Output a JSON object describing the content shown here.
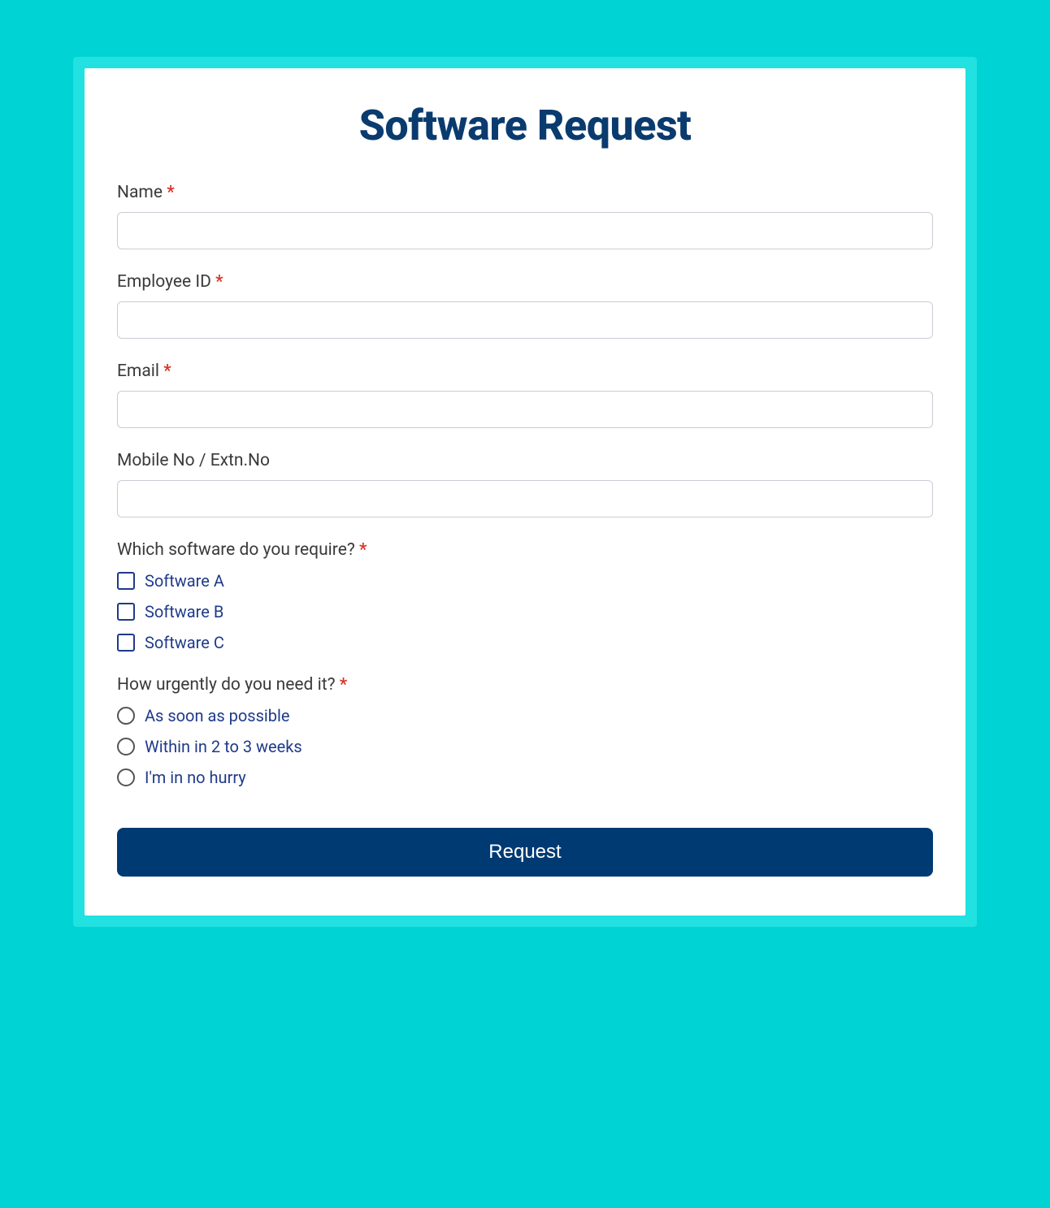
{
  "form": {
    "title": "Software Request",
    "fields": {
      "name": {
        "label": "Name",
        "required": true,
        "value": ""
      },
      "employee_id": {
        "label": "Employee ID",
        "required": true,
        "value": ""
      },
      "email": {
        "label": "Email",
        "required": true,
        "value": ""
      },
      "mobile": {
        "label": "Mobile No / Extn.No",
        "required": false,
        "value": ""
      }
    },
    "software": {
      "label": "Which software do you require?",
      "required": true,
      "options": [
        "Software A",
        "Software B",
        "Software C"
      ]
    },
    "urgency": {
      "label": "How urgently do you need it?",
      "required": true,
      "options": [
        "As soon as possible",
        "Within in 2 to 3 weeks",
        "I'm in no hurry"
      ]
    },
    "submit_label": "Request",
    "required_marker": "*"
  },
  "colors": {
    "page_bg": "#00d3d3",
    "card_border": "#21e1e1",
    "title": "#0a3b6f",
    "button_bg": "#003a73",
    "option_text": "#1f3a8a",
    "required": "#d93025"
  }
}
